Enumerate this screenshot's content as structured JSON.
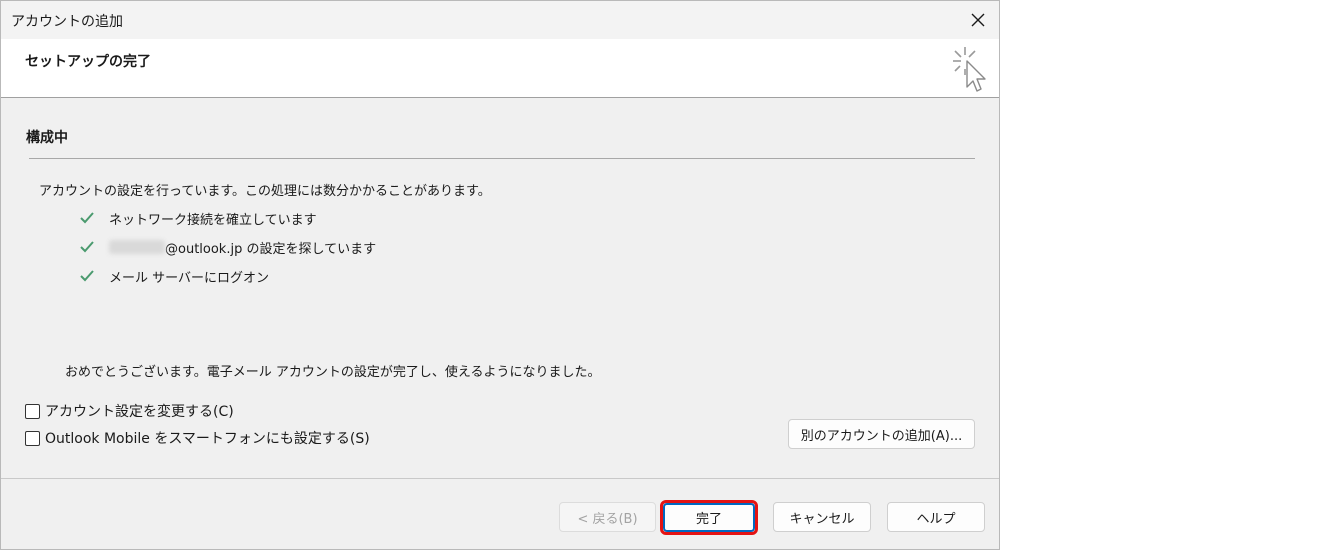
{
  "window": {
    "title": "アカウントの追加"
  },
  "header": {
    "title": "セットアップの完了"
  },
  "section": {
    "title": "構成中",
    "description": "アカウントの設定を行っています。この処理には数分かかることがあります。"
  },
  "steps": [
    {
      "text": "ネットワーク接続を確立しています"
    },
    {
      "text": "@outlook.jp の設定を探しています"
    },
    {
      "text": "メール サーバーにログオン"
    }
  ],
  "congrats": "おめでとうございます。電子メール アカウントの設定が完了し、使えるようになりました。",
  "checkboxes": [
    {
      "label": "アカウント設定を変更する(C)",
      "checked": false
    },
    {
      "label": "Outlook Mobile をスマートフォンにも設定する(S)",
      "checked": false
    }
  ],
  "buttons": {
    "add_another": "別のアカウントの追加(A)...",
    "back": "< 戻る(B)",
    "finish": "完了",
    "cancel": "キャンセル",
    "help": "ヘルプ"
  },
  "colors": {
    "check": "#4a9a6e",
    "highlight": "#e31313",
    "accent": "#0067c0"
  }
}
